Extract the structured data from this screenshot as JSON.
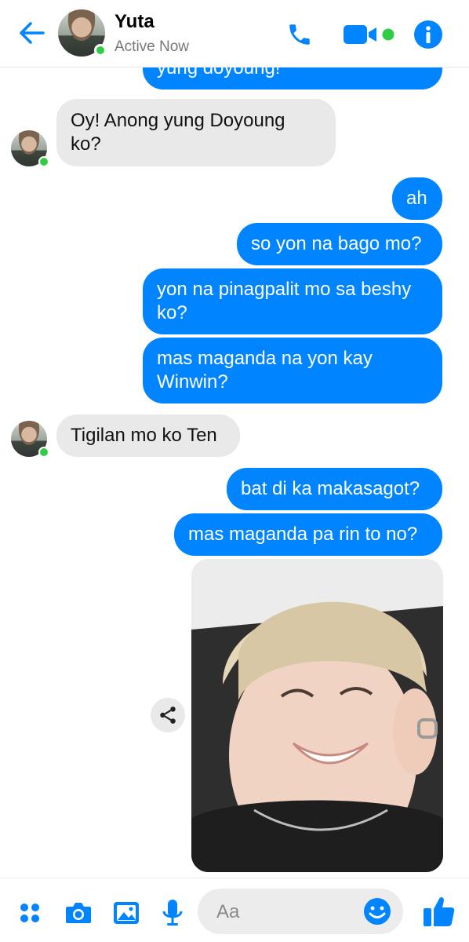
{
  "header": {
    "contact_name": "Yuta",
    "status": "Active Now",
    "accent_color": "#0084ff",
    "online_color": "#31cc46"
  },
  "messages": [
    {
      "side": "out",
      "text": "yung doyoung!"
    },
    {
      "side": "in",
      "lines": [
        "Oy! Anong yung Doyoung",
        "ko?"
      ]
    },
    {
      "side": "out",
      "text": "ah"
    },
    {
      "side": "out",
      "text": "so yon na bago mo?"
    },
    {
      "side": "out",
      "lines": [
        "yon na pinagpalit mo sa beshy",
        "ko?"
      ]
    },
    {
      "side": "out",
      "lines": [
        "mas maganda na yon kay",
        "Winwin?"
      ]
    },
    {
      "side": "in",
      "text": "Tigilan mo ko Ten"
    },
    {
      "side": "out",
      "text": "bat di ka makasagot?"
    },
    {
      "side": "out",
      "text": "mas maganda pa rin to no?"
    }
  ],
  "composer": {
    "placeholder": "Aa",
    "icons": [
      "apps-icon",
      "camera-icon",
      "gallery-icon",
      "microphone-icon",
      "emoji-icon",
      "thumbs-up-icon"
    ]
  }
}
